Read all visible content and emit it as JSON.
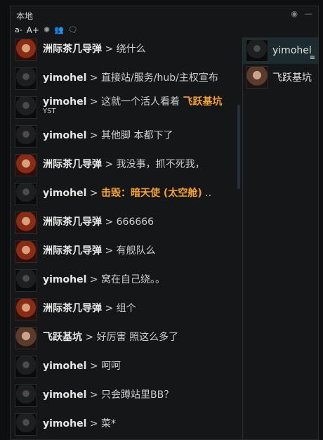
{
  "window": {
    "title": "本地"
  },
  "toolbar": {
    "font_decrease": "a-",
    "font_increase": "A+",
    "settings_icon": "gear-icon",
    "members_icon": "people-icon",
    "chat_icon": "chat-bubble-icon"
  },
  "titlebar_icons": {
    "settings": "circle-dot-icon",
    "minimize": "minus-icon"
  },
  "messages": [
    {
      "sender": "洲际茶几导弹",
      "sep": ">",
      "body": "绕什么",
      "avatar": "redhead-avatar"
    },
    {
      "sender": "yimohel",
      "sep": ">",
      "body": "直接站/服务/hub/主权宣布",
      "avatar": "bald-avatar"
    },
    {
      "sender": "yimohel",
      "sep": ">",
      "body": "这就一个活人看着 ",
      "highlight": "飞跃基坑",
      "subline": "YST",
      "avatar": "bald-avatar"
    },
    {
      "sender": "yimohel",
      "sep": ">",
      "body": "其他脚 本都下了",
      "avatar": "bald-avatar"
    },
    {
      "sender": "洲际茶几导弹",
      "sep": ">",
      "body": "我没事，抓不死我，",
      "avatar": "redhead-avatar"
    },
    {
      "sender": "yimohel",
      "sep": ">",
      "body": "",
      "highlight": "击毁：暗天使 (太空舱)",
      "suffix": " ..",
      "avatar": "bald-avatar"
    },
    {
      "sender": "洲际茶几导弹",
      "sep": ">",
      "body": "666666",
      "avatar": "redhead-avatar"
    },
    {
      "sender": "洲际茶几导弹",
      "sep": ">",
      "body": "有舰队么",
      "avatar": "redhead-avatar"
    },
    {
      "sender": "yimohel",
      "sep": ">",
      "body": "窝在自己绕。。",
      "avatar": "bald-avatar"
    },
    {
      "sender": "洲际茶几导弹",
      "sep": ">",
      "body": "组个",
      "avatar": "redhead-avatar"
    },
    {
      "sender": "飞跃基坑",
      "sep": ">",
      "body": "好厉害 照这么多了",
      "avatar": "beard-avatar"
    },
    {
      "sender": "yimohel",
      "sep": ">",
      "body": "呵呵",
      "avatar": "bald-avatar"
    },
    {
      "sender": "yimohel",
      "sep": ">",
      "body": "只会蹲站里BB？",
      "avatar": "bald-avatar"
    },
    {
      "sender": "yimohel",
      "sep": ">",
      "body": "菜*",
      "avatar": "bald-avatar"
    }
  ],
  "members": [
    {
      "name": "yimohel",
      "avatar": "bald-avatar",
      "selected": true,
      "icon": "≡"
    },
    {
      "name": "飞跃基坑",
      "avatar": "beard-avatar",
      "selected": false
    }
  ]
}
